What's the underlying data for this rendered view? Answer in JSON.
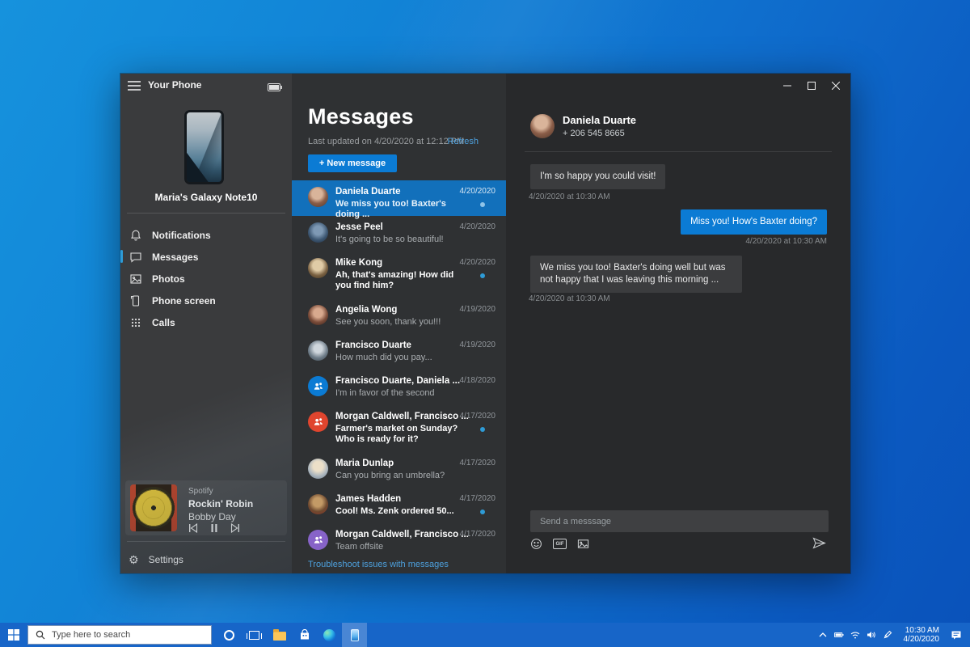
{
  "colors": {
    "accent_blue": "#0b7bd4",
    "selected_row_blue": "#1270bb",
    "unread_dot": "#2e9bd6",
    "taskbar_blue": "#1765c8",
    "desktop_gradient": [
      "#1692dd",
      "#0a52ba"
    ],
    "group_avatar_blue": "#0b7bd4",
    "group_avatar_red": "#e0452e",
    "group_avatar_purple": "#8763c8"
  },
  "icons": {
    "hamburger": "menu",
    "battery": "battery-full",
    "notifications": "bell",
    "messages": "chat-bubble",
    "photos": "image",
    "phone_screen": "phone",
    "calls": "dialpad",
    "settings": "gear ⚙",
    "media": [
      "skip-previous",
      "pause",
      "skip-next"
    ],
    "composer": [
      "emoji",
      "gif",
      "image",
      "send"
    ],
    "window_controls": [
      "minimize",
      "maximize",
      "close"
    ]
  },
  "window": {
    "title": "Your Phone",
    "sidebar": {
      "device_name": "Maria's Galaxy Note10",
      "nav": [
        {
          "label": "Notifications",
          "selected": false
        },
        {
          "label": "Messages",
          "selected": true
        },
        {
          "label": "Photos",
          "selected": false
        },
        {
          "label": "Phone screen",
          "selected": false
        },
        {
          "label": "Calls",
          "selected": false
        }
      ],
      "player": {
        "app": "Spotify",
        "track": "Rockin' Robin",
        "artist": "Bobby Day"
      },
      "settings_label": "Settings"
    },
    "messages_panel": {
      "title": "Messages",
      "last_updated": "Last updated on 4/20/2020 at 12:12 PM",
      "refresh_label": "Refresh",
      "new_message_label": "+ New message",
      "troubleshoot_label": "Troubleshoot issues with messages",
      "conversations": [
        {
          "name": "Daniela Duarte",
          "preview": "We miss you too! Baxter's doing ...",
          "date": "4/20/2020",
          "selected": true,
          "unread": true,
          "avatar": "photo"
        },
        {
          "name": "Jesse Peel",
          "preview": "It's going to be so beautiful!",
          "date": "4/20/2020",
          "selected": false,
          "unread": false,
          "avatar": "photo"
        },
        {
          "name": "Mike Kong",
          "preview": "Ah, that's amazing! How did you find him?",
          "date": "4/20/2020",
          "selected": false,
          "unread": true,
          "avatar": "photo"
        },
        {
          "name": "Angelia Wong",
          "preview": "See you soon, thank you!!!",
          "date": "4/19/2020",
          "selected": false,
          "unread": false,
          "avatar": "photo"
        },
        {
          "name": "Francisco Duarte",
          "preview": "How much did you pay...",
          "date": "4/19/2020",
          "selected": false,
          "unread": false,
          "avatar": "photo"
        },
        {
          "name": "Francisco Duarte, Daniela ...",
          "preview": "I'm in favor of the second",
          "date": "4/18/2020",
          "selected": false,
          "unread": false,
          "avatar": "group-blue"
        },
        {
          "name": "Morgan Caldwell, Francisco ...",
          "preview": "Farmer's market on Sunday? Who is ready for it?",
          "date": "4/17/2020",
          "selected": false,
          "unread": true,
          "avatar": "group-red"
        },
        {
          "name": "Maria Dunlap",
          "preview": "Can you bring an umbrella?",
          "date": "4/17/2020",
          "selected": false,
          "unread": false,
          "avatar": "photo"
        },
        {
          "name": "James Hadden",
          "preview": "Cool! Ms. Zenk ordered 50...",
          "date": "4/17/2020",
          "selected": false,
          "unread": true,
          "avatar": "photo"
        },
        {
          "name": "Morgan Caldwell, Francisco ...",
          "preview": "Team offsite",
          "date": "4/17/2020",
          "selected": false,
          "unread": false,
          "avatar": "group-purple"
        }
      ]
    },
    "thread_panel": {
      "contact_name": "Daniela Duarte",
      "contact_phone": "+ 206 545 8665",
      "messages": [
        {
          "direction": "in",
          "text": "I'm so happy you could visit!",
          "timestamp": "4/20/2020 at 10:30 AM"
        },
        {
          "direction": "out",
          "text": "Miss you! How's Baxter doing?",
          "timestamp": "4/20/2020 at 10:30 AM"
        },
        {
          "direction": "in",
          "text": "We miss you too! Baxter's doing well but was not happy that I was leaving this morning ...",
          "timestamp": "4/20/2020 at 10:30 AM"
        }
      ],
      "composer": {
        "placeholder": "Send a messsage",
        "gif_label": "GIF"
      }
    }
  },
  "taskbar": {
    "search_placeholder": "Type here to search",
    "clock": {
      "time": "10:30 AM",
      "date": "4/20/2020"
    }
  }
}
